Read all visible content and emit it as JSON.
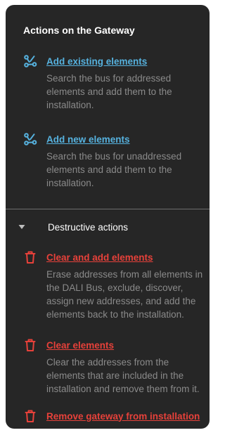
{
  "panel": {
    "title": "Actions on the Gateway"
  },
  "actions": [
    {
      "label": "Add existing elements",
      "description": "Search the bus for addressed elements and add them to the installation.",
      "icon": "nodes-icon"
    },
    {
      "label": "Add new elements",
      "description": "Search the bus for unaddressed elements and add them to the installation.",
      "icon": "nodes-icon"
    }
  ],
  "destructive": {
    "title": "Destructive actions",
    "expanded": true,
    "items": [
      {
        "label": "Clear and add elements",
        "description": "Erase addresses from all elements in the DALI Bus, exclude, discover, assign new addresses, and add the elements back to the installation.",
        "icon": "trash-icon"
      },
      {
        "label": "Clear elements",
        "description": "Clear the addresses from the elements that are included in the installation and remove them from it.",
        "icon": "trash-icon"
      },
      {
        "label": "Remove gateway from installation",
        "icon": "trash-icon"
      }
    ]
  },
  "colors": {
    "panel_bg": "#262626",
    "link_blue": "#56b2df",
    "link_red": "#e7413a",
    "desc_text": "#8a8a8a"
  }
}
